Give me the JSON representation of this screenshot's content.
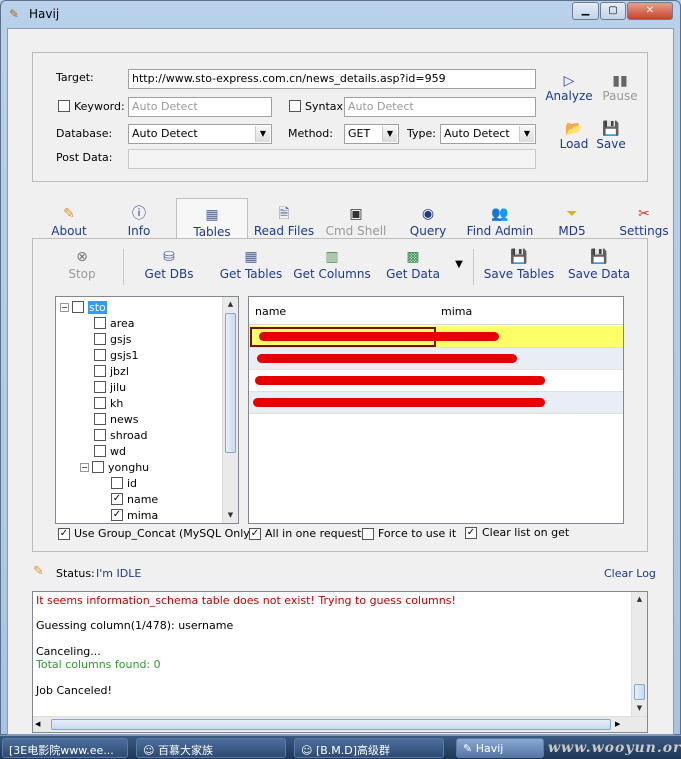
{
  "window": {
    "title": "Havij"
  },
  "form": {
    "target_label": "Target:",
    "target_value": "http://www.sto-express.com.cn/news_details.asp?id=959",
    "keyword_label": "Keyword:",
    "keyword_value": "Auto Detect",
    "syntax_label": "Syntax:",
    "syntax_value": "Auto Detect",
    "database_label": "Database:",
    "database_value": "Auto Detect",
    "method_label": "Method:",
    "method_value": "GET",
    "type_label": "Type:",
    "type_value": "Auto Detect",
    "postdata_label": "Post Data:",
    "postdata_value": ""
  },
  "side_buttons": {
    "analyze": "Analyze",
    "pause": "Pause",
    "load": "Load",
    "save": "Save"
  },
  "tabs": [
    "About",
    "Info",
    "Tables",
    "Read Files",
    "Cmd Shell",
    "Query",
    "Find Admin",
    "MD5",
    "Settings"
  ],
  "toolbar": {
    "stop": "Stop",
    "get_dbs": "Get DBs",
    "get_tables": "Get Tables",
    "get_columns": "Get Columns",
    "get_data": "Get Data",
    "save_tables": "Save Tables",
    "save_data": "Save Data"
  },
  "tree": {
    "root": "sto",
    "tables": [
      "area",
      "gsjs",
      "gsjs1",
      "jbzl",
      "jilu",
      "kh",
      "news",
      "shroad",
      "wd",
      "yonghu"
    ],
    "columns": [
      "id",
      "name",
      "mima"
    ]
  },
  "grid": {
    "columns": [
      "name",
      "mima"
    ]
  },
  "options": {
    "group_concat": "Use Group_Concat (MySQL Only)",
    "all_in_one": "All in one request.",
    "force": "Force to use it",
    "clear_list": "Clear list on get"
  },
  "status": {
    "label": "Status:",
    "value": "I'm IDLE",
    "clear_log": "Clear Log"
  },
  "log": [
    {
      "text": "It seems information_schema table does not exist! Trying to guess columns!",
      "color": "#c00000"
    },
    {
      "text": "",
      "color": "#000000"
    },
    {
      "text": "Guessing column(1/478): username",
      "color": "#000000"
    },
    {
      "text": "",
      "color": "#000000"
    },
    {
      "text": "Canceling...",
      "color": "#000000"
    },
    {
      "text": "Total columns found: 0",
      "color": "#2e9a2e"
    },
    {
      "text": "",
      "color": "#000000"
    },
    {
      "text": "Job Canceled!",
      "color": "#000000"
    }
  ],
  "taskbar": [
    "[3E电影院www.ee...",
    "百慕大家族",
    "[B.M.D]高级群",
    "Havij"
  ],
  "watermark": "www.wooyun.org",
  "colors": {
    "accent_blue": "#1d3a8a",
    "row_highlight": "#ffff66",
    "row_alt": "#e8eef4",
    "redaction": "#e60000"
  }
}
